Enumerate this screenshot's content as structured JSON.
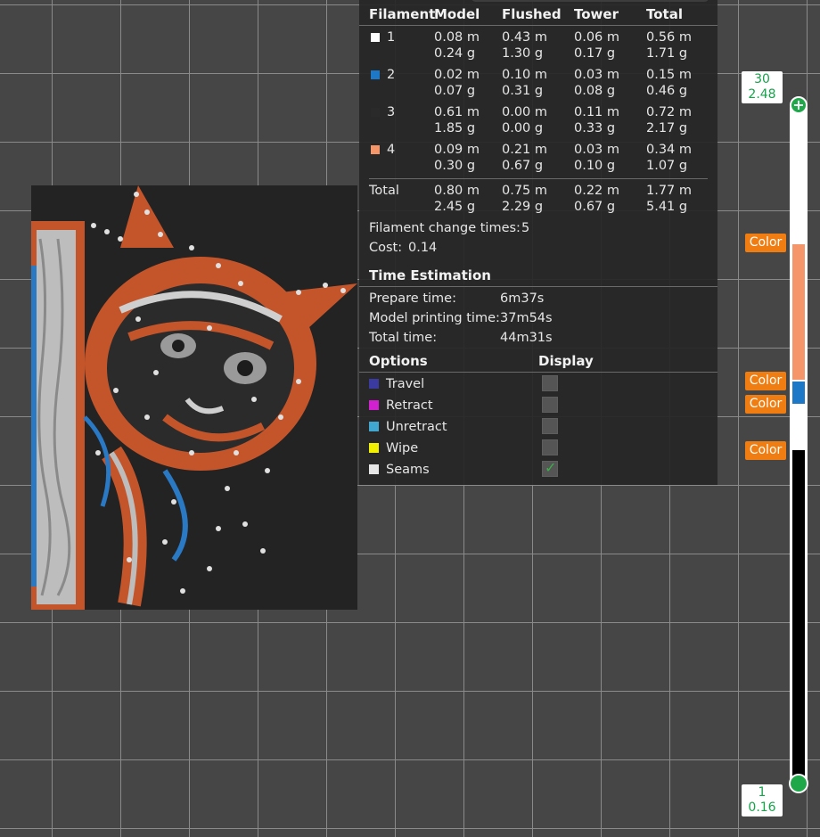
{
  "filament_table": {
    "headers": [
      "Filament",
      "Model",
      "Flushed",
      "Tower",
      "Total"
    ],
    "rows": [
      {
        "id": "1",
        "color": "#ffffff",
        "model_len": "0.08 m",
        "model_wt": "0.24 g",
        "flushed_len": "0.43 m",
        "flushed_wt": "1.30 g",
        "tower_len": "0.06 m",
        "tower_wt": "0.17 g",
        "total_len": "0.56 m",
        "total_wt": "1.71 g"
      },
      {
        "id": "2",
        "color": "#1e78c8",
        "model_len": "0.02 m",
        "model_wt": "0.07 g",
        "flushed_len": "0.10 m",
        "flushed_wt": "0.31 g",
        "tower_len": "0.03 m",
        "tower_wt": "0.08 g",
        "total_len": "0.15 m",
        "total_wt": "0.46 g"
      },
      {
        "id": "3",
        "color": "#2a2a2a",
        "model_len": "0.61 m",
        "model_wt": "1.85 g",
        "flushed_len": "0.00 m",
        "flushed_wt": "0.00 g",
        "tower_len": "0.11 m",
        "tower_wt": "0.33 g",
        "total_len": "0.72 m",
        "total_wt": "2.17 g"
      },
      {
        "id": "4",
        "color": "#f4956a",
        "model_len": "0.09 m",
        "model_wt": "0.30 g",
        "flushed_len": "0.21 m",
        "flushed_wt": "0.67 g",
        "tower_len": "0.03 m",
        "tower_wt": "0.10 g",
        "total_len": "0.34 m",
        "total_wt": "1.07 g"
      }
    ],
    "total": {
      "label": "Total",
      "model_len": "0.80 m",
      "model_wt": "2.45 g",
      "flushed_len": "0.75 m",
      "flushed_wt": "2.29 g",
      "tower_len": "0.22 m",
      "tower_wt": "0.67 g",
      "total_len": "1.77 m",
      "total_wt": "5.41 g"
    }
  },
  "summary": {
    "change_label": "Filament change times:",
    "change_value": "5",
    "cost_label": "Cost:",
    "cost_value": "0.14"
  },
  "time_estimation": {
    "title": "Time Estimation",
    "rows": [
      {
        "label": "Prepare time:",
        "value": "6m37s"
      },
      {
        "label": "Model printing time:",
        "value": "37m54s"
      },
      {
        "label": "Total time:",
        "value": "44m31s"
      }
    ]
  },
  "options": {
    "header_options": "Options",
    "header_display": "Display",
    "items": [
      {
        "label": "Travel",
        "color": "#3a3aa0",
        "checked": false
      },
      {
        "label": "Retract",
        "color": "#d020d0",
        "checked": false
      },
      {
        "label": "Unretract",
        "color": "#40a8d0",
        "checked": false
      },
      {
        "label": "Wipe",
        "color": "#f0f000",
        "checked": false
      },
      {
        "label": "Seams",
        "color": "#e6e6e6",
        "checked": true
      }
    ]
  },
  "slider": {
    "top_layer": "30",
    "top_height": "2.48",
    "bottom_layer": "1",
    "bottom_height": "0.16",
    "color_button": "Color",
    "colors": {
      "handle": "#1fa84a",
      "orange": "#f4956a",
      "blue": "#1e78c8",
      "black": "#000000",
      "button": "#f07d12"
    }
  }
}
